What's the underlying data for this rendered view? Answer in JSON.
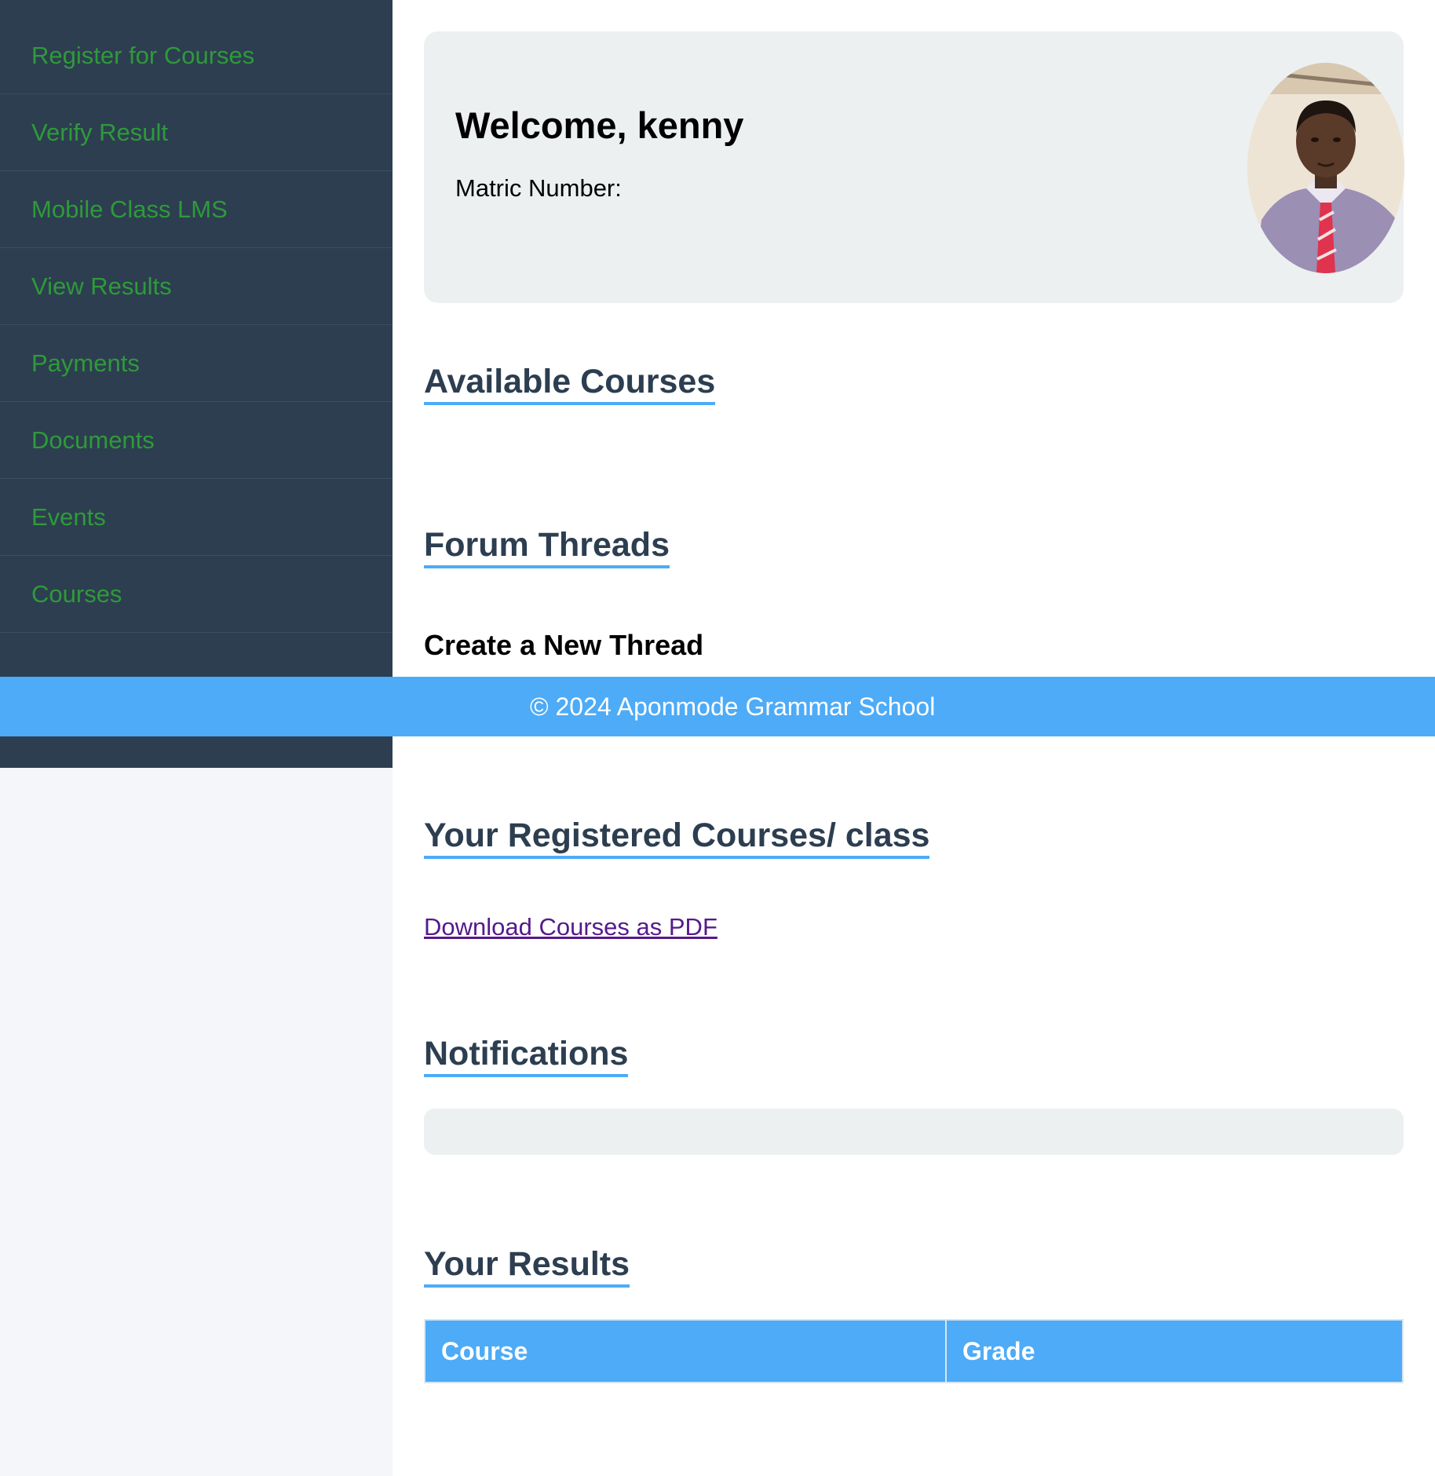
{
  "sidebar": {
    "items": [
      {
        "label": "Register for Courses"
      },
      {
        "label": "Verify Result"
      },
      {
        "label": "Mobile Class LMS"
      },
      {
        "label": "View Results"
      },
      {
        "label": "Payments"
      },
      {
        "label": "Documents"
      },
      {
        "label": "Events"
      },
      {
        "label": "Courses"
      }
    ]
  },
  "welcome": {
    "title": "Welcome, kenny",
    "matric_label": "Matric Number:"
  },
  "sections": {
    "available_courses": "Available Courses",
    "forum_threads": "Forum Threads",
    "create_thread": "Create a New Thread",
    "registered_courses": "Your Registered Courses/ class",
    "download_pdf": "Download Courses as PDF",
    "notifications": "Notifications",
    "results": "Your Results"
  },
  "results_table": {
    "headers": [
      "Course",
      "Grade"
    ]
  },
  "footer": {
    "text": "© 2024 Aponmode Grammar School"
  },
  "colors": {
    "sidebar_bg": "#2d3e50",
    "sidebar_link": "#2e9a3a",
    "accent": "#4dabf7",
    "heading": "#2c3e50",
    "card_bg": "#ecf0f1",
    "visited_link": "#551a8b"
  }
}
